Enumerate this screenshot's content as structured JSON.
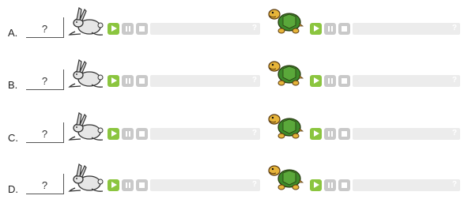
{
  "rows": [
    {
      "letter": "A.",
      "answer": "?"
    },
    {
      "letter": "B.",
      "answer": "?"
    },
    {
      "letter": "C.",
      "answer": "?"
    },
    {
      "letter": "D.",
      "answer": "?"
    }
  ],
  "audio_track_help": "?",
  "icons": {
    "left_animal": "rabbit-icon",
    "right_animal": "turtle-icon",
    "play": "play-icon",
    "pause": "pause-icon",
    "stop": "stop-icon"
  },
  "colors": {
    "play_button": "#8bc53f",
    "disabled_button": "#c9c9c9",
    "track": "#ececec"
  }
}
